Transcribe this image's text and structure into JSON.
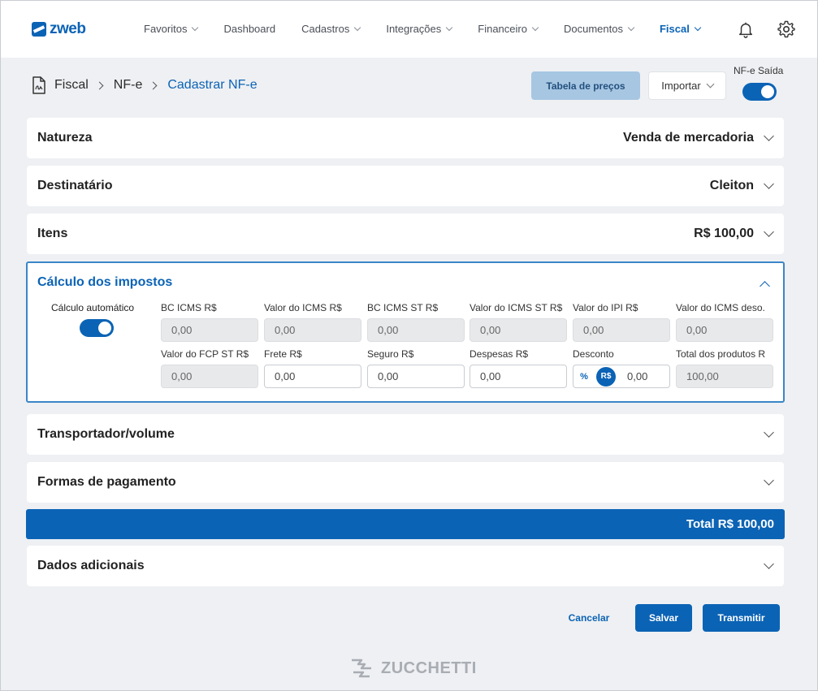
{
  "app": {
    "logo_text": "zweb",
    "brand_text": "ZUCCHETTI"
  },
  "nav": {
    "items": [
      {
        "label": "Favoritos",
        "active": false
      },
      {
        "label": "Dashboard",
        "active": false
      },
      {
        "label": "Cadastros",
        "active": false
      },
      {
        "label": "Integrações",
        "active": false
      },
      {
        "label": "Financeiro",
        "active": false
      },
      {
        "label": "Documentos",
        "active": false
      },
      {
        "label": "Fiscal",
        "active": true
      }
    ],
    "icons": [
      "bell-icon",
      "gear-icon"
    ]
  },
  "breadcrumb": {
    "items": [
      "Fiscal",
      "NF-e",
      "Cadastrar NF-e"
    ]
  },
  "actions": {
    "tabela_label": "Tabela de preços",
    "importar_label": "Importar",
    "nfe_saida_label": "NF-e Saída",
    "nfe_saida_on": true
  },
  "sections": {
    "natureza": {
      "title": "Natureza",
      "value": "Venda de mercadoria"
    },
    "destinatario": {
      "title": "Destinatário",
      "value": "Cleiton"
    },
    "itens": {
      "title": "Itens",
      "value": "R$ 100,00"
    },
    "transportador": {
      "title": "Transportador/volume"
    },
    "pagamento": {
      "title": "Formas de pagamento"
    },
    "adicionais": {
      "title": "Dados adicionais"
    }
  },
  "calculo": {
    "title": "Cálculo dos impostos",
    "auto_label": "Cálculo automático",
    "auto_on": true,
    "fields": [
      {
        "label": "BC ICMS R$",
        "value": "0,00",
        "readonly": true
      },
      {
        "label": "Valor do ICMS R$",
        "value": "0,00",
        "readonly": true
      },
      {
        "label": "BC ICMS ST R$",
        "value": "0,00",
        "readonly": true
      },
      {
        "label": "Valor do ICMS ST R$",
        "value": "0,00",
        "readonly": true
      },
      {
        "label": "Valor do IPI R$",
        "value": "0,00",
        "readonly": true
      },
      {
        "label": "Valor do ICMS deso.",
        "value": "0,00",
        "readonly": true
      },
      {
        "label": "Valor do FCP ST R$",
        "value": "0,00",
        "readonly": true
      },
      {
        "label": "Frete R$",
        "value": "0,00",
        "readonly": false
      },
      {
        "label": "Seguro R$",
        "value": "0,00",
        "readonly": false
      },
      {
        "label": "Despesas R$",
        "value": "0,00",
        "readonly": false
      },
      {
        "label": "Desconto",
        "value": "0,00",
        "readonly": false,
        "pct_label": "%",
        "rs_label": "R$"
      },
      {
        "label": "Total dos produtos R",
        "value": "100,00",
        "readonly": true
      }
    ]
  },
  "total": {
    "label": "Total R$ 100,00"
  },
  "footer": {
    "cancel_label": "Cancelar",
    "save_label": "Salvar",
    "send_label": "Transmitir"
  },
  "colors": {
    "primary": "#0b63b5",
    "light_button": "#a7c6e2",
    "background": "#eef0f3"
  }
}
